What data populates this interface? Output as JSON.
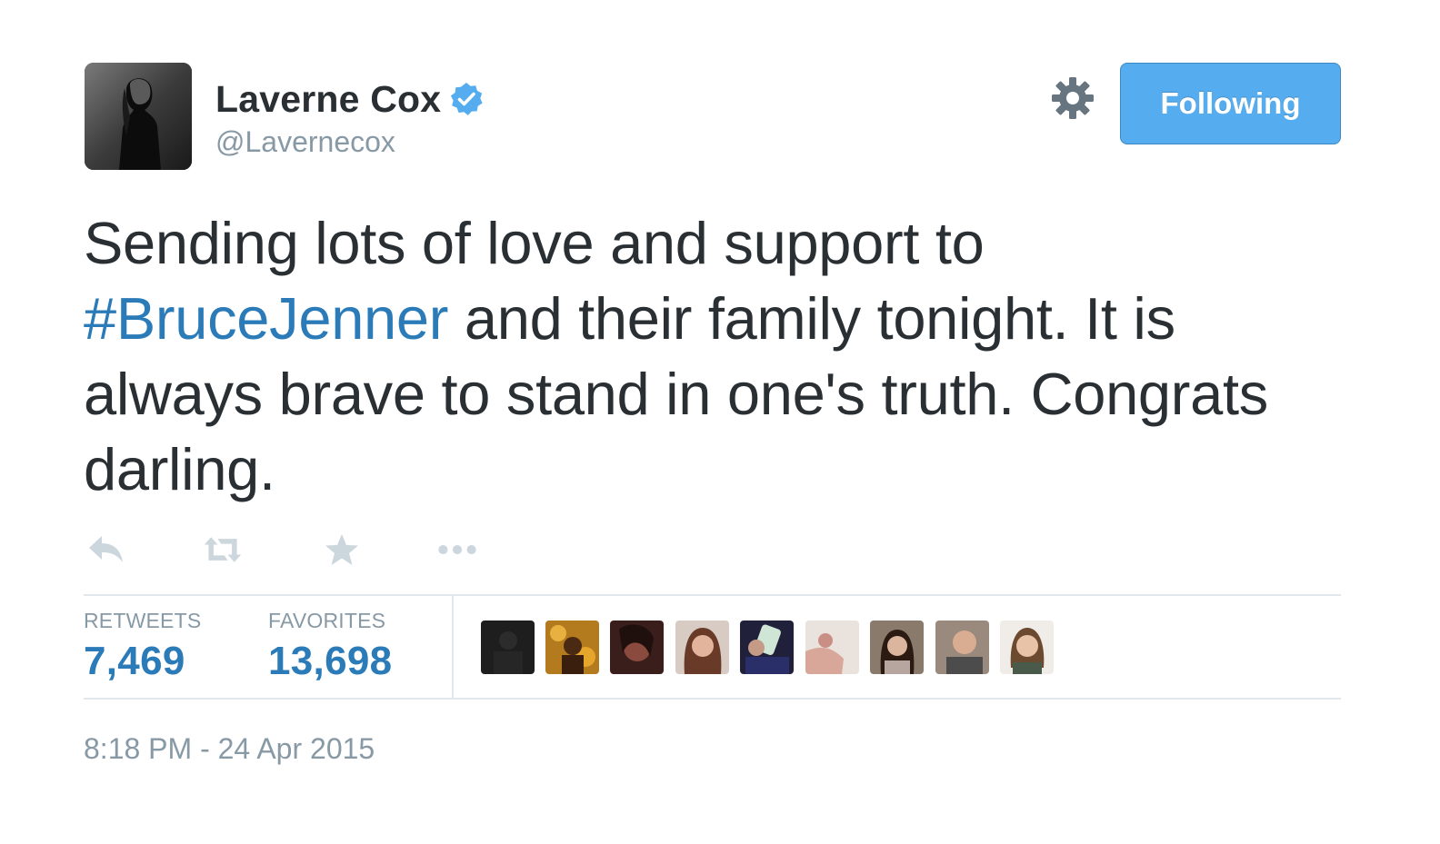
{
  "author": {
    "display_name": "Laverne Cox",
    "handle": "@Lavernecox",
    "verified": true
  },
  "follow_button": {
    "label": "Following"
  },
  "tweet": {
    "text_before": "Sending lots of love and support to ",
    "hashtag": "#BruceJenner",
    "text_after": " and their family tonight. It is always brave to stand in one's truth. Congrats darling."
  },
  "actions": {
    "icons": [
      "reply-icon",
      "retweet-icon",
      "favorite-icon",
      "more-icon"
    ]
  },
  "stats": {
    "retweets_label": "RETWEETS",
    "retweets_value": "7,469",
    "favorites_label": "FAVORITES",
    "favorites_value": "13,698"
  },
  "timestamp": "8:18 PM - 24 Apr 2015",
  "colors": {
    "text": "#292f33",
    "muted": "#8899a6",
    "link": "#2b7bb9",
    "button_bg": "#55acee",
    "verified": "#55acee",
    "icon": "#ccd6dd",
    "divider": "#e1e8ed"
  }
}
